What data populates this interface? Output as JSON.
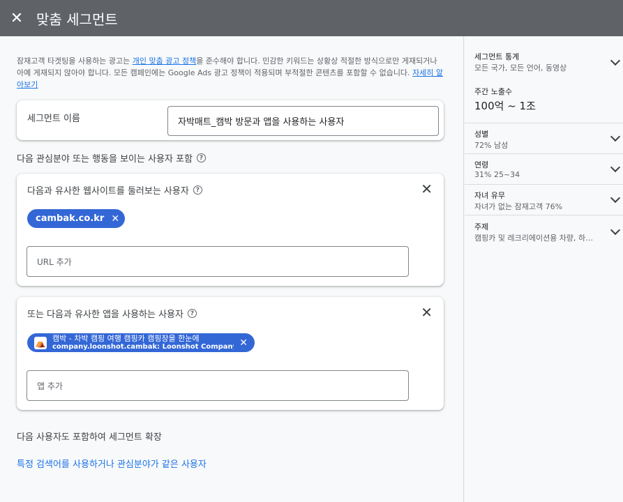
{
  "header": {
    "title": "맞춤 세그먼트"
  },
  "policy": {
    "text1": "잠재고객 타겟팅을 사용하는 광고는 ",
    "link1": "개인 맞춤 광고 정책",
    "text2": "을 준수해야 합니다. 민감한 키워드는 상황상 적절한 방식으로만 게재되거나 아예 게재되지 않아야 합니다. 모든 캠페인에는 Google Ads 광고 정책이 적용되며 부적절한 콘텐츠를 포함할 수 없습니다. ",
    "link2": "자세히 알아보기"
  },
  "segment_name": {
    "label": "세그먼트 이름",
    "value": "자박매트_캠박 방문과 앱을 사용하는 사용자"
  },
  "include_label": "다음 관심분야 또는 행동을 보이는 사용자 포함",
  "web_card": {
    "title": "다음과 유사한 웹사이트를 둘러보는 사용자",
    "chip": "cambak.co.kr",
    "input_placeholder": "URL 추가"
  },
  "app_card": {
    "title": "또는 다음과 유사한 앱을 사용하는 사용자",
    "chip_line1": "캠박 - 차박 캠핑 여행 캠핑카 캠핑장을 한눈에",
    "chip_line2": "company.loonshot.cambak: Loonshot Company Inc.",
    "input_placeholder": "앱 추가"
  },
  "expand": {
    "label": "다음 사용자도 포함하여 세그먼트 확장",
    "link": "특정 검색어를 사용하거나 관심분야가 같은 사용자"
  },
  "stats": {
    "title": "세그먼트 통계",
    "subtitle": "모든 국가, 모든 언어, 동영상",
    "reach_label": "주간 노출수",
    "reach_value": "100억 ~ 1조",
    "rows": [
      {
        "title": "성별",
        "value": "72% 남성"
      },
      {
        "title": "연령",
        "value": "31% 25~34"
      },
      {
        "title": "자녀 유무",
        "value": "자녀가 없는 잠재고객 76%"
      },
      {
        "title": "주제",
        "value": "캠핑카 및 레크리에이션용 차량, 하…"
      }
    ]
  },
  "icons": {
    "close": "close-icon",
    "help": "help-icon",
    "chevron": "chevron-down-icon",
    "app": "app-icon"
  }
}
